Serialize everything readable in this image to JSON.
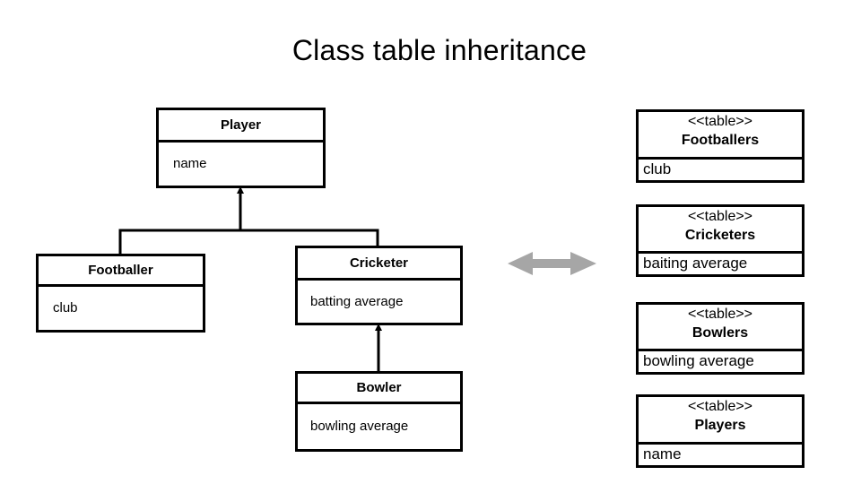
{
  "title": "Class table inheritance",
  "classes": {
    "player": {
      "name": "Player",
      "attribute": "name"
    },
    "footballer": {
      "name": "Footballer",
      "attribute": "club"
    },
    "cricketer": {
      "name": "Cricketer",
      "attribute": "batting average"
    },
    "bowler": {
      "name": "Bowler",
      "attribute": "bowling average"
    }
  },
  "mapping_arrow": {
    "icon": "double-headed-arrow-icon",
    "color": "#a6a6a6"
  },
  "tables": [
    {
      "stereotype": "<<table>>",
      "name": "Footballers",
      "column": "club"
    },
    {
      "stereotype": "<<table>>",
      "name": "Cricketers",
      "column": "baiting average"
    },
    {
      "stereotype": "<<table>>",
      "name": "Bowlers",
      "column": "bowling average"
    },
    {
      "stereotype": "<<table>>",
      "name": "Players",
      "column": "name"
    }
  ]
}
